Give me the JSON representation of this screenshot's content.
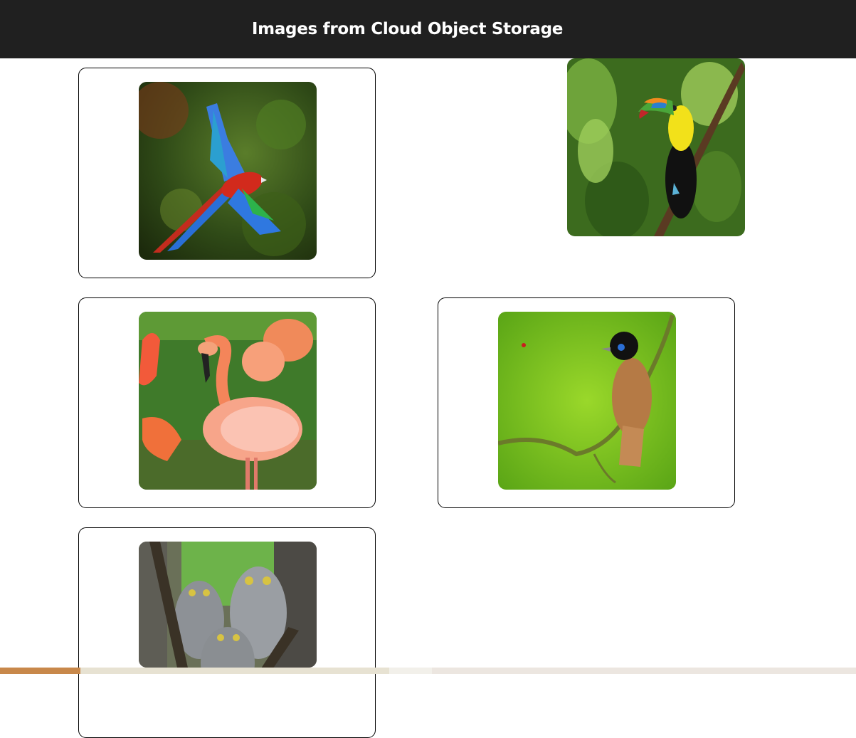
{
  "header": {
    "title": "Images from Cloud Object Storage"
  },
  "images": [
    {
      "subject": "scarlet macaw in flight"
    },
    {
      "subject": "keel-billed toucan on branch"
    },
    {
      "subject": "pink flamingos"
    },
    {
      "subject": "paradise flycatcher on vine"
    },
    {
      "subject": "screech owl chicks"
    }
  ],
  "colors": {
    "header_bg": "#202020",
    "header_text": "#ffffff",
    "card_border": "#000000"
  }
}
